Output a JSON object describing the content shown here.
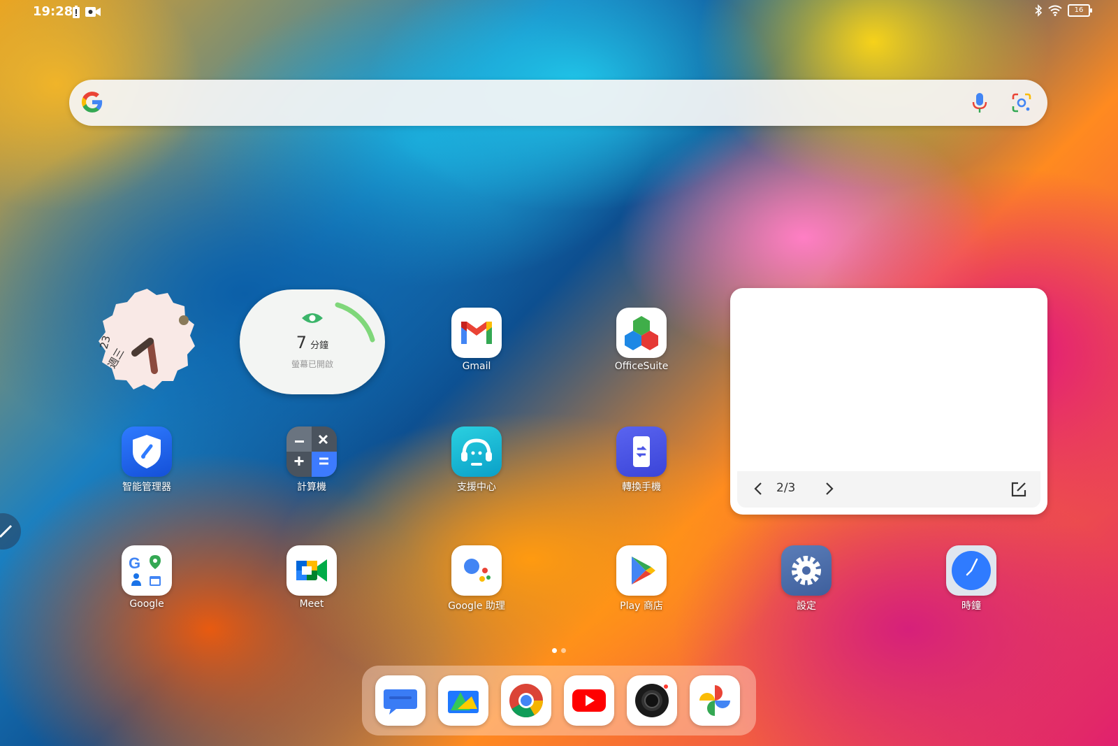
{
  "status_bar": {
    "time": "19:28",
    "battery": "16"
  },
  "search": {
    "placeholder": ""
  },
  "clock_widget": {
    "date": "23",
    "weekday": "週三"
  },
  "screen_time": {
    "value": "7",
    "unit": "分鐘",
    "subtitle": "螢幕已開啟",
    "progress": 0.25
  },
  "apps_row1": [
    {
      "label": "Gmail"
    },
    {
      "label": "OfficeSuite"
    }
  ],
  "apps_row2": [
    {
      "label": "智能管理器"
    },
    {
      "label": "計算機"
    },
    {
      "label": "支援中心"
    },
    {
      "label": "轉換手機"
    }
  ],
  "apps_row3": [
    {
      "label": "Google"
    },
    {
      "label": "Meet"
    },
    {
      "label": "Google 助理"
    },
    {
      "label": "Play 商店"
    },
    {
      "label": "設定"
    },
    {
      "label": "時鐘"
    }
  ],
  "note_widget": {
    "page": "2/3"
  },
  "dock": [
    "messages",
    "files",
    "chrome",
    "youtube",
    "camera",
    "photos"
  ],
  "colors": {
    "accent": "#1a73e8",
    "wallpaper_blue": "#0b5fa8",
    "wallpaper_orange": "#ff8a20",
    "wallpaper_pink": "#e0206e"
  }
}
